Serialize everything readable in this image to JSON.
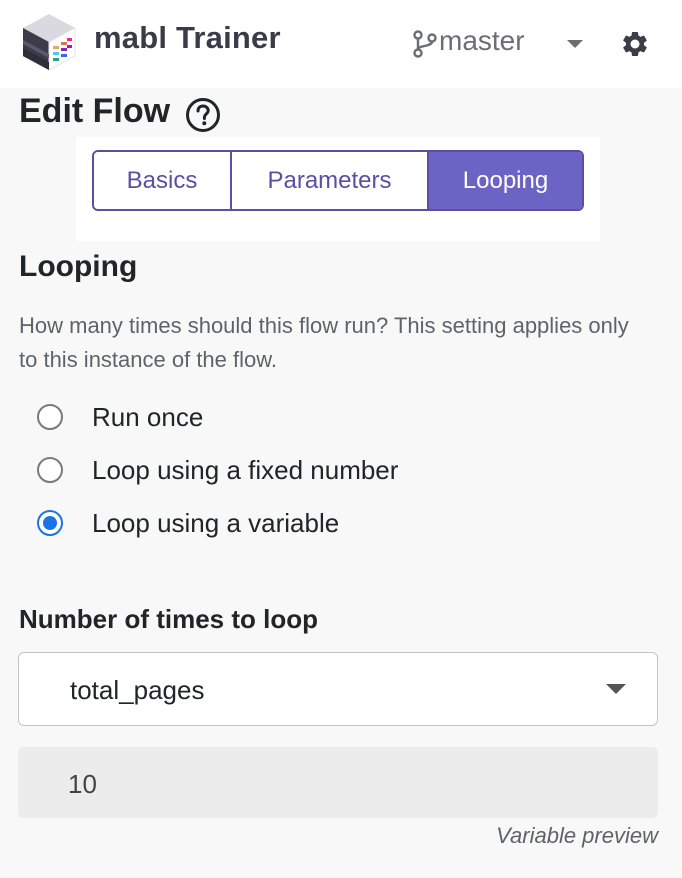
{
  "header": {
    "app_title": "mabl Trainer",
    "branch": "master",
    "icons": [
      "mabl-logo-icon",
      "git-branch-icon",
      "chevron-down-icon",
      "gear-icon"
    ]
  },
  "page": {
    "title": "Edit Flow",
    "help_icon": "question-circle-icon"
  },
  "tabs": [
    {
      "label": "Basics",
      "active": false
    },
    {
      "label": "Parameters",
      "active": false
    },
    {
      "label": "Looping",
      "active": true
    }
  ],
  "looping": {
    "title": "Looping",
    "description": "How many times should this flow run? This setting applies only to this instance of the flow.",
    "options": [
      {
        "label": "Run once",
        "selected": false
      },
      {
        "label": "Loop using a fixed number",
        "selected": false
      },
      {
        "label": "Loop using a variable",
        "selected": true
      }
    ],
    "field_label": "Number of times to loop",
    "selected_variable": "total_pages",
    "preview_value": "10",
    "preview_caption": "Variable preview"
  },
  "colors": {
    "accent": "#6b64c4",
    "tab_border": "#5b4fa3",
    "radio_selected": "#1a73e8"
  }
}
